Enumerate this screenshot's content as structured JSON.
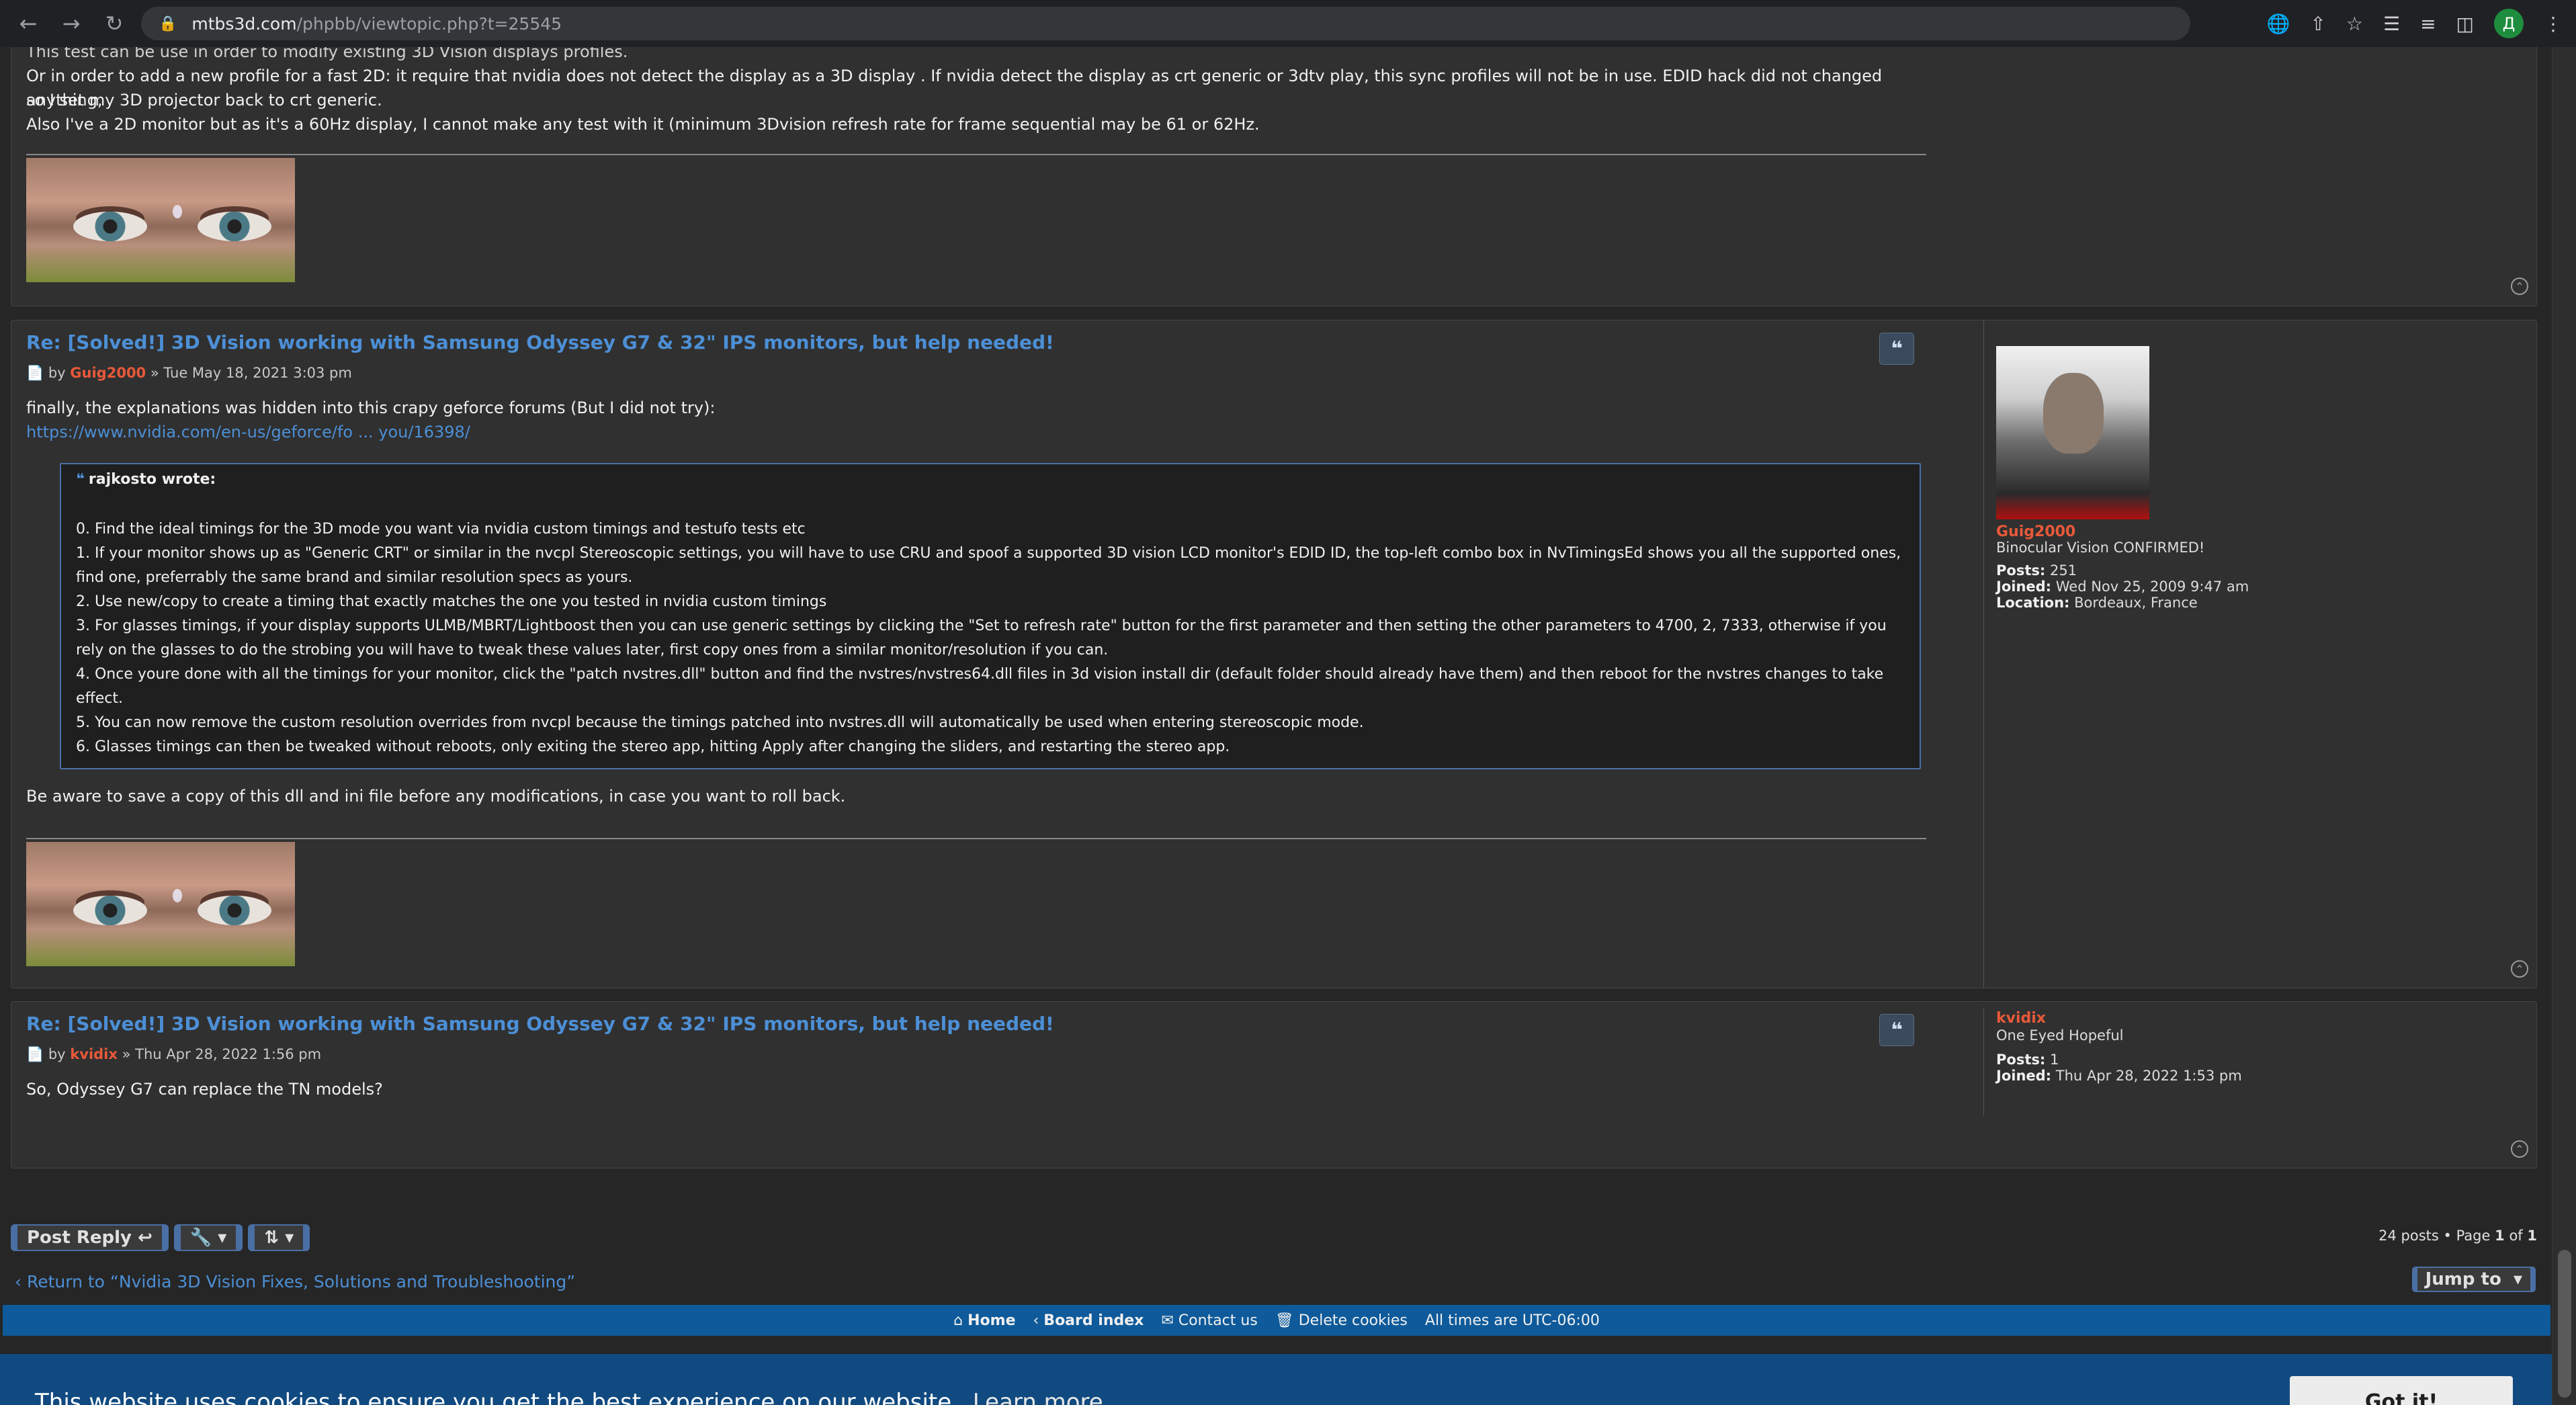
{
  "browser": {
    "url_host": "mtbs3d.com",
    "url_path": "/phpbb/viewtopic.php?t=25545",
    "profile_initial": "Д"
  },
  "posts": [
    {
      "partial": true,
      "lines": [
        "This test can be use in order to modify existing 3D Vision displays profiles.",
        "Or in order to add a new profile for a fast 2D: it require that nvidia does not detect the display as a 3D display . If nvidia detect the display as crt generic or 3dtv play, this sync profiles will not be in use. EDID hack did not changed anything,",
        "so I set my 3D projector back to crt generic.",
        "Also I've a 2D monitor but as it's a 60Hz display, I cannot make any test with it (minimum 3Dvision refresh rate for frame sequential may be 61 or 62Hz."
      ]
    },
    {
      "title": "Re: [Solved!] 3D Vision working with Samsung Odyssey G7 & 32\" IPS monitors, but help needed!",
      "meta_by": "by",
      "author": "Guig2000",
      "meta_date": "» Tue May 18, 2021 3:03 pm",
      "intro": "finally, the explanations was hidden into this crapy geforce forums (But I did not try):",
      "link": "https://www.nvidia.com/en-us/geforce/fo ... you/16398/",
      "quote_author": "rajkosto wrote:",
      "quote_lines": [
        "0. Find the ideal timings for the 3D mode you want via nvidia custom timings and testufo tests etc",
        "1. If your monitor shows up as \"Generic CRT\" or similar in the nvcpl Stereoscopic settings, you will have to use CRU and spoof a supported 3D vision LCD monitor's EDID ID, the top-left combo box in NvTimingsEd shows you all the supported ones,",
        "find one, preferrably the same brand and similar resolution specs as yours.",
        "2. Use new/copy to create a timing that exactly matches the one you tested in nvidia custom timings",
        "3. For glasses timings, if your display supports ULMB/MBRT/Lightboost then you can use generic settings by clicking the \"Set to refresh rate\" button for the first parameter and then setting the other parameters to 4700, 2, 7333, otherwise if you",
        "rely on the glasses to do the strobing you will have to tweak these values later, first copy ones from a similar monitor/resolution if you can.",
        "4. Once youre done with all the timings for your monitor, click the \"patch nvstres.dll\" button and find the nvstres/nvstres64.dll files in 3d vision install dir (default folder should already have them) and then reboot for the nvstres changes to take",
        "effect.",
        "5. You can now remove the custom resolution overrides from nvcpl because the timings patched into nvstres.dll will automatically be used when entering stereoscopic mode.",
        "6. Glasses timings can then be tweaked without reboots, only exiting the stereo app, hitting Apply after changing the sliders, and restarting the stereo app."
      ],
      "outro": "Be aware to save a copy of this dll and ini file before any modifications, in case you want to roll back.",
      "profile": {
        "username": "Guig2000",
        "rank": "Binocular Vision CONFIRMED!",
        "posts_label": "Posts:",
        "posts": "251",
        "joined_label": "Joined:",
        "joined": "Wed Nov 25, 2009 9:47 am",
        "location_label": "Location:",
        "location": "Bordeaux, France"
      }
    },
    {
      "title": "Re: [Solved!] 3D Vision working with Samsung Odyssey G7 & 32\" IPS monitors, but help needed!",
      "meta_by": "by",
      "author": "kvidix",
      "meta_date": "» Thu Apr 28, 2022 1:56 pm",
      "body": "So, Odyssey G7 can replace the TN models?",
      "profile": {
        "username": "kvidix",
        "rank": "One Eyed Hopeful",
        "posts_label": "Posts:",
        "posts": "1",
        "joined_label": "Joined:",
        "joined": "Thu Apr 28, 2022 1:53 pm"
      }
    }
  ],
  "actions": {
    "post_reply": "Post Reply",
    "pagination_prefix": "24 posts • Page",
    "page_current": "1",
    "page_of": "of",
    "page_total": "1",
    "return_link": "Return to “Nvidia 3D Vision Fixes, Solutions and Troubleshooting”",
    "jump_to": "Jump to"
  },
  "footer": {
    "home": "Home",
    "board_index": "Board index",
    "contact": "Contact us",
    "delete_cookies": "Delete cookies",
    "timezone": "All times are UTC-06:00"
  },
  "cookie_banner": {
    "message": "This website uses cookies to ensure you get the best experience on our website.",
    "learn_more": "Learn more",
    "accept": "Got it!"
  },
  "colors": {
    "link": "#4c8fd6",
    "username": "#e8593a",
    "footer_bg": "#0e5a9a",
    "cookie_bg": "#114a80"
  }
}
